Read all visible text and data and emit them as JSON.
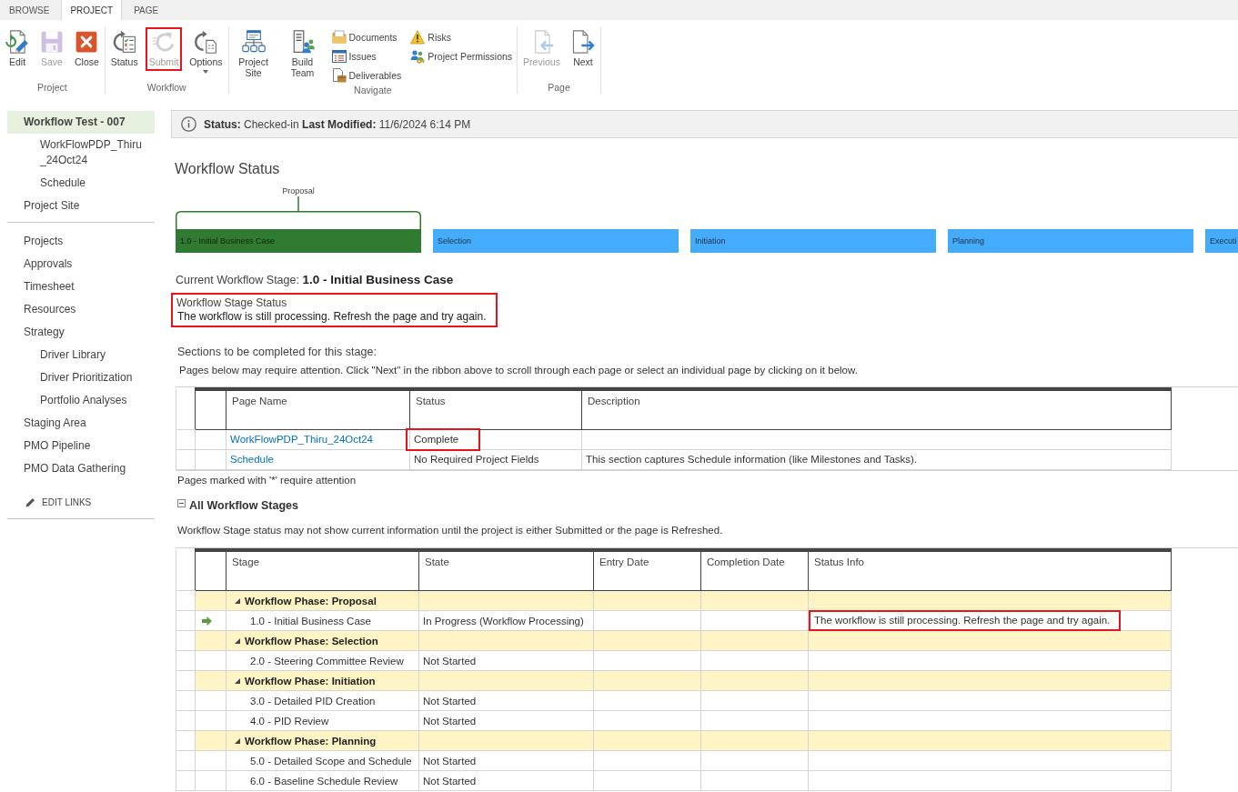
{
  "ribbon": {
    "tabs": [
      {
        "label": "BROWSE",
        "selected": false
      },
      {
        "label": "PROJECT",
        "selected": true
      },
      {
        "label": "PAGE",
        "selected": false
      }
    ],
    "groups": [
      {
        "label": "Project",
        "items": [
          {
            "kind": "large",
            "label": "Edit",
            "disabled": false,
            "highlighted": false
          },
          {
            "kind": "large",
            "label": "Save",
            "disabled": true,
            "highlighted": false
          },
          {
            "kind": "large",
            "label": "Close",
            "disabled": false,
            "highlighted": false
          }
        ]
      },
      {
        "label": "Workflow",
        "items": [
          {
            "kind": "large",
            "label": "Status",
            "disabled": false,
            "highlighted": false
          },
          {
            "kind": "large",
            "label": "Submit",
            "disabled": true,
            "highlighted": true
          },
          {
            "kind": "menu",
            "label": "Options",
            "disabled": false,
            "highlighted": false
          }
        ]
      },
      {
        "label": "Navigate",
        "items": [
          {
            "kind": "large",
            "label": "Project Site",
            "disabled": false,
            "highlighted": false
          },
          {
            "kind": "large",
            "label": "Build Team",
            "disabled": false,
            "highlighted": false
          },
          {
            "kind": "small",
            "label": "Documents",
            "disabled": false,
            "highlighted": false
          },
          {
            "kind": "small",
            "label": "Issues",
            "disabled": false,
            "highlighted": false
          },
          {
            "kind": "small",
            "label": "Deliverables",
            "disabled": false,
            "highlighted": false
          },
          {
            "kind": "small",
            "label": "Risks",
            "disabled": false,
            "highlighted": false
          },
          {
            "kind": "small",
            "label": "Project Permissions",
            "disabled": false,
            "highlighted": false
          }
        ]
      },
      {
        "label": "Page",
        "items": [
          {
            "kind": "large",
            "label": "Previous",
            "disabled": true,
            "highlighted": false
          },
          {
            "kind": "large",
            "label": "Next",
            "disabled": false,
            "highlighted": false
          }
        ]
      }
    ]
  },
  "sidebar": {
    "sections": [
      {
        "items": [
          {
            "label": "Workflow Test - 007",
            "selected": true,
            "children": [
              {
                "label": "WorkFlowPDP_Thiru_24Oct24",
                "selected": false
              },
              {
                "label": "Schedule",
                "selected": false
              }
            ]
          },
          {
            "label": "Project Site",
            "selected": false
          }
        ]
      },
      {
        "items": [
          {
            "label": "Projects",
            "selected": false
          },
          {
            "label": "Approvals",
            "selected": false
          },
          {
            "label": "Timesheet",
            "selected": false
          },
          {
            "label": "Resources",
            "selected": false
          },
          {
            "label": "Strategy",
            "selected": false,
            "children": [
              {
                "label": "Driver Library",
                "selected": false
              },
              {
                "label": "Driver Prioritization",
                "selected": false
              },
              {
                "label": "Portfolio Analyses",
                "selected": false
              }
            ]
          },
          {
            "label": "Staging Area",
            "selected": false
          },
          {
            "label": "PMO Pipeline",
            "selected": false
          },
          {
            "label": "PMO Data Gathering",
            "selected": false
          }
        ]
      }
    ],
    "edit_links": "EDIT LINKS"
  },
  "status_bar": {
    "text": "**Status:** Checked-in **Last Modified:** 11/6/2024 6:14 PM"
  },
  "workflow": {
    "title": "Workflow Status",
    "phase_label": "Proposal",
    "stages": [
      {
        "label": "1.0 - Initial Business Case",
        "current": true
      },
      {
        "label": "Selection",
        "current": false
      },
      {
        "label": "Initiation",
        "current": false
      },
      {
        "label": "Planning",
        "current": false
      },
      {
        "label": "Executi",
        "current": false
      }
    ],
    "current_stage": "Current Workflow Stage: **1.0 - Initial Business Case**",
    "stage_status": {
      "label": "Workflow Stage Status",
      "message": "The workflow is still processing. Refresh the page and try again.",
      "highlighted": true
    }
  },
  "sections": {
    "title": "Sections to be completed for this stage:",
    "hint": "Pages below may require attention. Click \"Next\" in the ribbon above to scroll through each page or select an individual page by clicking on it below.",
    "columns": [
      "Page Name",
      "Status",
      "Description"
    ],
    "rows": [
      {
        "page_name": "WorkFlowPDP_Thiru_24Oct24",
        "status": "Complete",
        "highlighted": true
      },
      {
        "page_name": "Schedule",
        "status": "No Required Project Fields",
        "description": "This section captures Schedule information (like Milestones and Tasks).",
        "highlighted": false
      }
    ],
    "footnote": "Pages marked with '*' require attention"
  },
  "all_stages": {
    "title": "All Workflow Stages",
    "expanded": true,
    "note": "Workflow Stage status may not show current information until the project is either Submitted or the page is Refreshed.",
    "columns": [
      "Stage",
      "State",
      "Entry Date",
      "Completion Date",
      "Status Info"
    ],
    "phases": [
      {
        "label": "Workflow Phase: Proposal",
        "expanded": true,
        "children": [
          {
            "stage": "1.0 - Initial Business Case",
            "state": "In Progress (Workflow Processing)",
            "current": true,
            "status_info": "The workflow is still processing. Refresh the page and try again.",
            "highlighted": true
          }
        ]
      },
      {
        "label": "Workflow Phase: Selection",
        "expanded": true,
        "children": [
          {
            "stage": "2.0 - Steering Committee Review",
            "state": "Not Started",
            "current": false,
            "highlighted": false
          }
        ]
      },
      {
        "label": "Workflow Phase: Initiation",
        "expanded": true,
        "children": [
          {
            "stage": "3.0 - Detailed PID Creation",
            "state": "Not Started",
            "current": false,
            "highlighted": false
          },
          {
            "stage": "4.0 - PID Review",
            "state": "Not Started",
            "current": false,
            "highlighted": false
          }
        ]
      },
      {
        "label": "Workflow Phase: Planning",
        "expanded": true,
        "children": [
          {
            "stage": "5.0 - Detailed Scope and Schedule",
            "state": "Not Started",
            "current": false,
            "highlighted": false
          },
          {
            "stage": "6.0 - Baseline Schedule Review",
            "state": "Not Started",
            "current": false,
            "highlighted": false
          }
        ]
      }
    ]
  }
}
